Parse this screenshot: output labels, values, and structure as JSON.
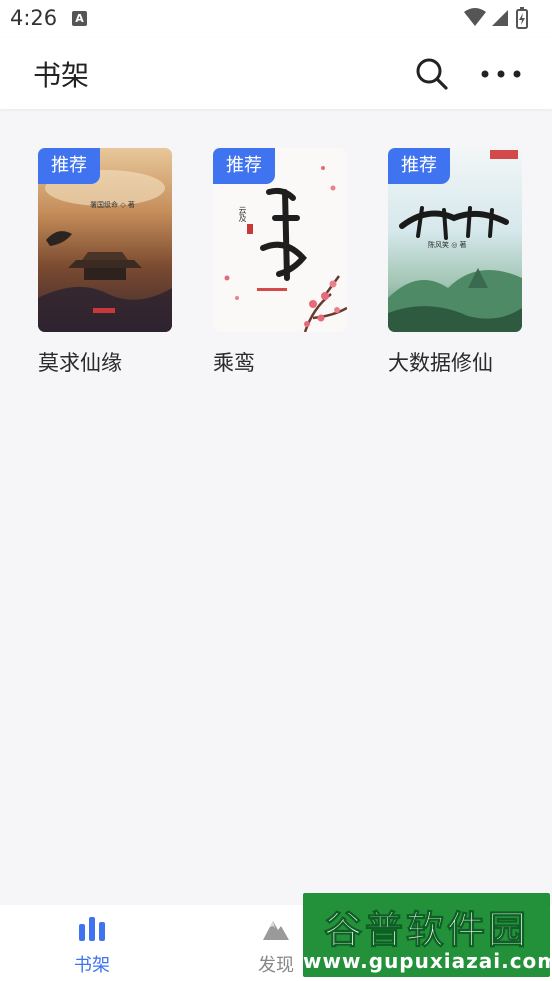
{
  "status_bar": {
    "time": "4:26",
    "notification_icon": "A"
  },
  "header": {
    "title": "书架"
  },
  "books": [
    {
      "title": "莫求仙缘",
      "badge": "推荐",
      "cover_author": "署国级命 ◇ 著"
    },
    {
      "title": "乘鸾",
      "badge": "推荐",
      "cover_author": "云及"
    },
    {
      "title": "大数据修仙",
      "badge": "推荐",
      "cover_author": "陈风笑 ◎ 著"
    }
  ],
  "bottom_nav": {
    "items": [
      {
        "label": "书架",
        "icon": "bookshelf-icon",
        "active": true
      },
      {
        "label": "发现",
        "icon": "mountain-icon",
        "active": false
      }
    ]
  },
  "watermark": {
    "text": "谷普软件园",
    "url": "www.gupuxiazai.com"
  },
  "colors": {
    "accent": "#3f73f0",
    "inactive": "#888888",
    "background": "#f6f6f9"
  }
}
